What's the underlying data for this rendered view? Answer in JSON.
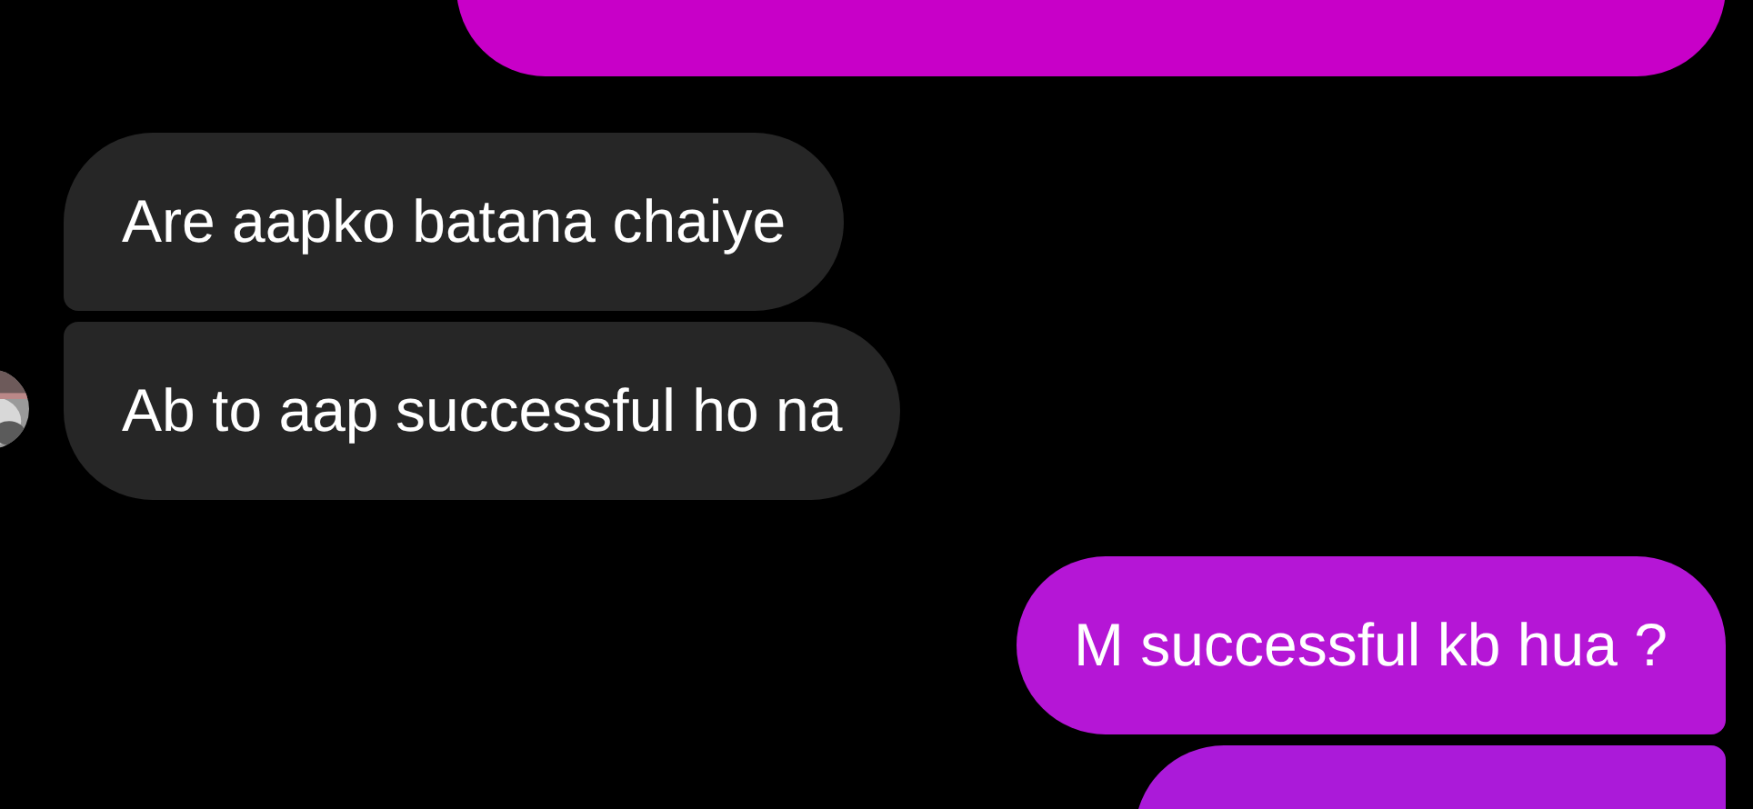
{
  "messages": [
    {
      "kind": "sent",
      "color": "#c800c8"
    },
    {
      "kind": "received",
      "text": "Are aapko batana chaiye"
    },
    {
      "kind": "received",
      "text": "Ab to aap successful ho na",
      "avatar": true
    },
    {
      "kind": "sent",
      "text": "M successful kb hua ?",
      "color": "#b516d6"
    },
    {
      "kind": "sent",
      "color": "#ab1ad9"
    }
  ]
}
